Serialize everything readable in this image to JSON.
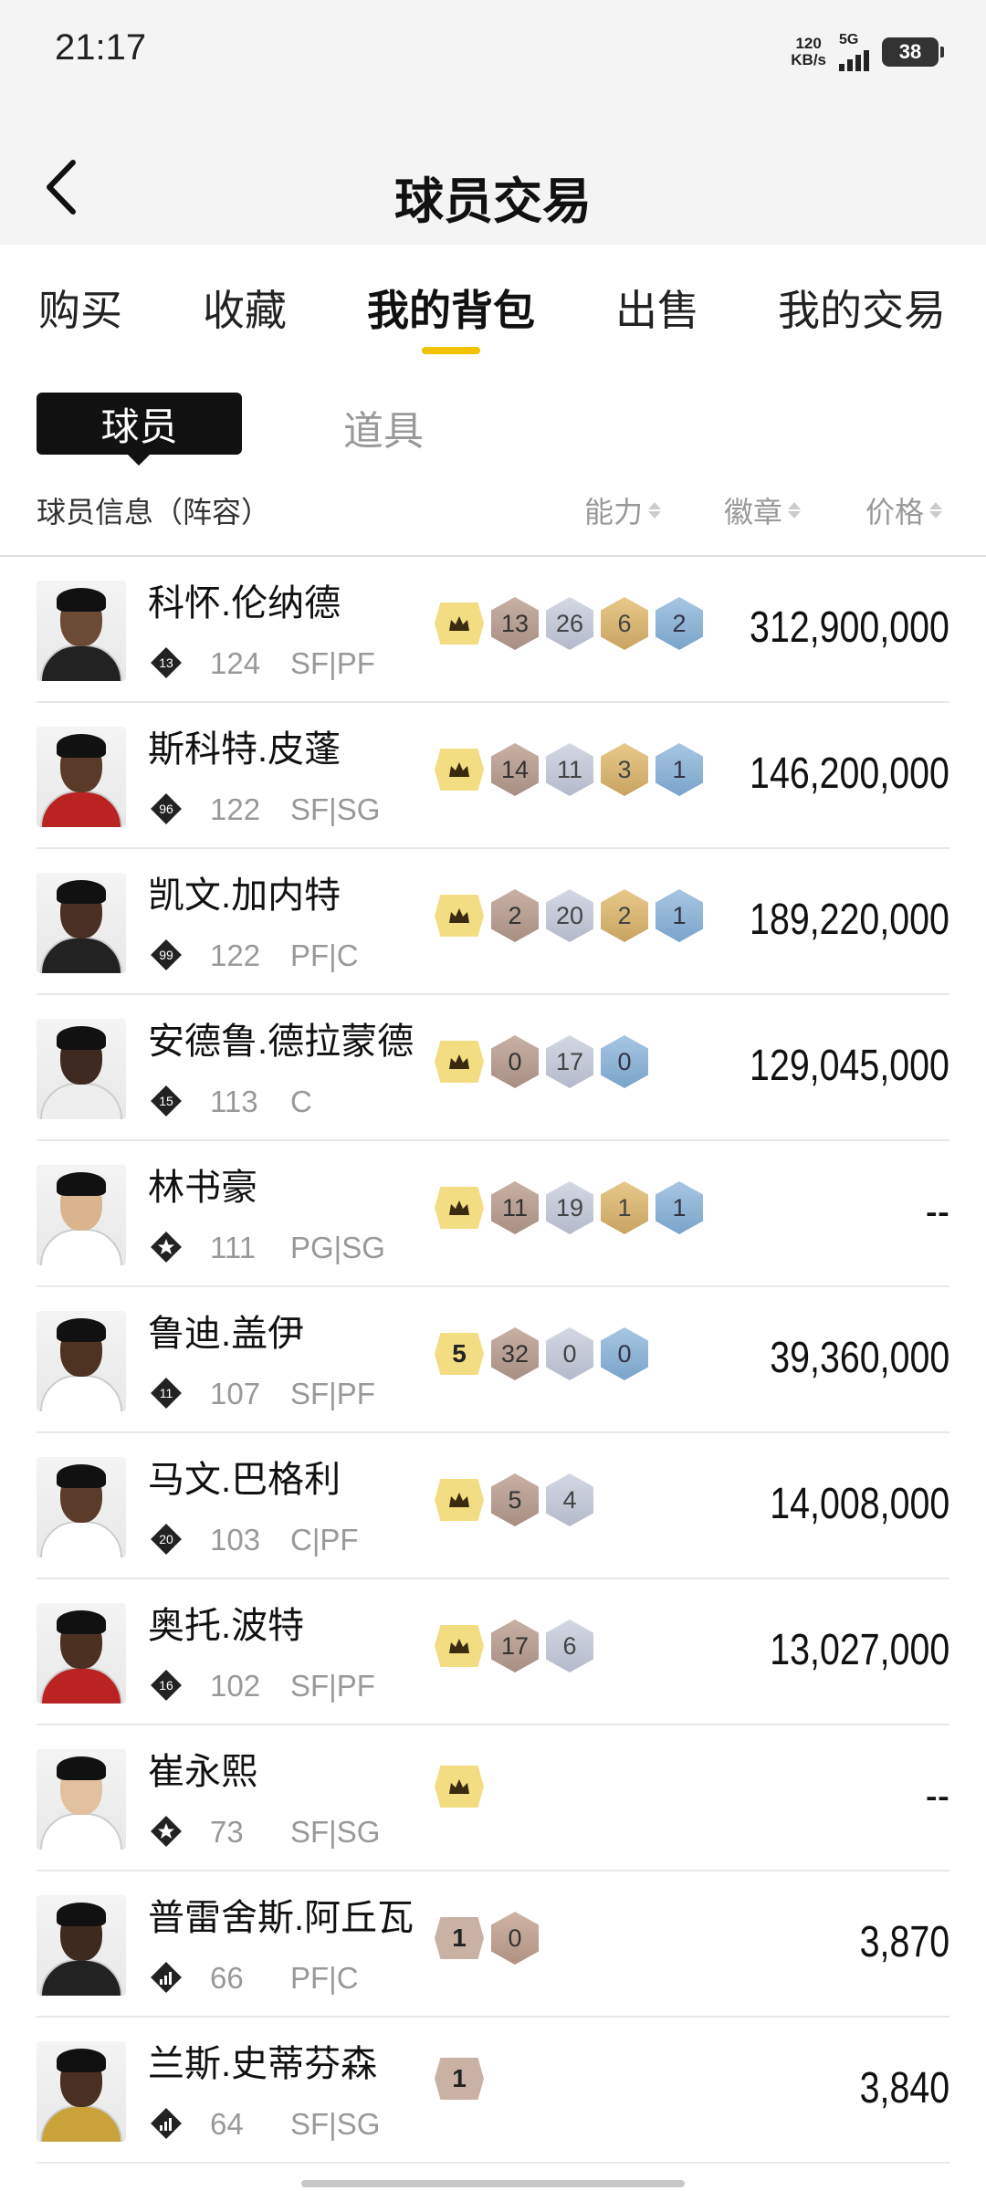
{
  "status_bar": {
    "time": "21:17",
    "net_speed_value": "120",
    "net_speed_unit": "KB/s",
    "network_type": "5G",
    "battery": "38"
  },
  "header": {
    "title": "球员交易",
    "back_icon": "chevron-left-icon"
  },
  "tabs": [
    {
      "label": "购买",
      "active": false
    },
    {
      "label": "收藏",
      "active": false
    },
    {
      "label": "我的背包",
      "active": true
    },
    {
      "label": "出售",
      "active": false
    },
    {
      "label": "我的交易",
      "active": false
    }
  ],
  "segment": {
    "active": "球员",
    "inactive": "道具"
  },
  "columns": {
    "info": "球员信息（阵容）",
    "ability": "能力",
    "badges": "徽章",
    "price": "价格"
  },
  "colors": {
    "accent": "#f2c200",
    "crown_badge": "#f3dd82"
  },
  "players": [
    {
      "name": "科怀.伦纳德",
      "jersey": "13",
      "overall": "124",
      "position": "SF|PF",
      "tier": "crown",
      "badges": [
        "13",
        "26",
        "6",
        "2"
      ],
      "badge_kinds": [
        "bronze",
        "silver",
        "gold",
        "blue"
      ],
      "price": "312,900,000"
    },
    {
      "name": "斯科特.皮蓬",
      "jersey": "96",
      "overall": "122",
      "position": "SF|SG",
      "tier": "crown",
      "badges": [
        "14",
        "11",
        "3",
        "1"
      ],
      "badge_kinds": [
        "bronze",
        "silver",
        "gold",
        "blue"
      ],
      "price": "146,200,000"
    },
    {
      "name": "凯文.加内特",
      "jersey": "99",
      "overall": "122",
      "position": "PF|C",
      "tier": "crown",
      "badges": [
        "2",
        "20",
        "2",
        "1"
      ],
      "badge_kinds": [
        "bronze",
        "silver",
        "gold",
        "blue"
      ],
      "price": "189,220,000"
    },
    {
      "name": "安德鲁.德拉蒙德",
      "jersey": "15",
      "overall": "113",
      "position": "C",
      "tier": "crown",
      "badges": [
        "0",
        "17",
        "0"
      ],
      "badge_kinds": [
        "bronze",
        "silver",
        "blue"
      ],
      "price": "129,045,000"
    },
    {
      "name": "林书豪",
      "jersey": "★",
      "overall": "111",
      "position": "PG|SG",
      "tier": "crown",
      "badges": [
        "11",
        "19",
        "1",
        "1"
      ],
      "badge_kinds": [
        "bronze",
        "silver",
        "gold",
        "blue"
      ],
      "price": "--"
    },
    {
      "name": "鲁迪.盖伊",
      "jersey": "11",
      "overall": "107",
      "position": "SF|PF",
      "tier": "5",
      "badges": [
        "32",
        "0",
        "0"
      ],
      "badge_kinds": [
        "bronze",
        "silver",
        "blue"
      ],
      "price": "39,360,000"
    },
    {
      "name": "马文.巴格利",
      "jersey": "20",
      "overall": "103",
      "position": "C|PF",
      "tier": "crown",
      "badges": [
        "5",
        "4"
      ],
      "badge_kinds": [
        "bronze",
        "silver"
      ],
      "price": "14,008,000"
    },
    {
      "name": "奥托.波特",
      "jersey": "16",
      "overall": "102",
      "position": "SF|PF",
      "tier": "crown",
      "badges": [
        "17",
        "6"
      ],
      "badge_kinds": [
        "bronze",
        "silver"
      ],
      "price": "13,027,000"
    },
    {
      "name": "崔永熙",
      "jersey": "★",
      "overall": "73",
      "position": "SF|SG",
      "tier": "crown",
      "badges": [],
      "badge_kinds": [],
      "price": "--"
    },
    {
      "name": "普雷舍斯.阿丘瓦",
      "jersey": "bars",
      "overall": "66",
      "position": "PF|C",
      "tier": "1",
      "badges": [
        "0"
      ],
      "badge_kinds": [
        "tan2"
      ],
      "price": "3,870"
    },
    {
      "name": "兰斯.史蒂芬森",
      "jersey": "bars",
      "overall": "64",
      "position": "SF|SG",
      "tier": "1",
      "badges": [],
      "badge_kinds": [],
      "price": "3,840"
    }
  ]
}
